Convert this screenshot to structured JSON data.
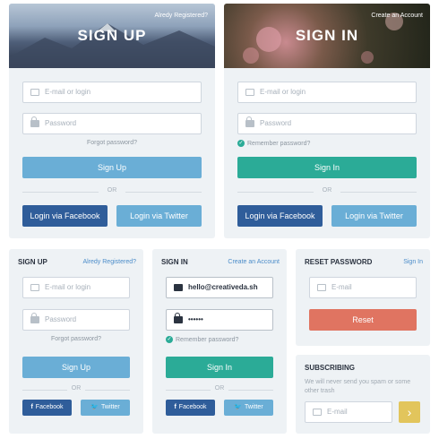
{
  "card1": {
    "title": "SIGN UP",
    "top_link": "Alredy Registered?",
    "email_placeholder": "E-mail or login",
    "password_placeholder": "Password",
    "forgot": "Forgot password?",
    "primary_button": "Sign Up",
    "or": "OR",
    "fb_button": "Login via Facebook",
    "tw_button": "Login via Twitter"
  },
  "card2": {
    "title": "SIGN IN",
    "top_link": "Create an Account",
    "email_placeholder": "E-mail or login",
    "password_placeholder": "Password",
    "remember": "Remember password?",
    "primary_button": "Sign In",
    "or": "OR",
    "fb_button": "Login via Facebook",
    "tw_button": "Login via Twitter"
  },
  "card3": {
    "title": "SIGN UP",
    "top_link": "Alredy Registered?",
    "email_placeholder": "E-mail or login",
    "password_placeholder": "Password",
    "forgot": "Forgot password?",
    "primary_button": "Sign Up",
    "or": "OR",
    "fb_button": "Facebook",
    "tw_button": "Twitter"
  },
  "card4": {
    "title": "SIGN IN",
    "top_link": "Create an Account",
    "email_value": "hello@creativeda.sh",
    "password_value": "••••••",
    "remember": "Remember password?",
    "primary_button": "Sign In",
    "or": "OR",
    "fb_button": "Facebook",
    "tw_button": "Twitter"
  },
  "card5": {
    "title": "RESET PASSWORD",
    "top_link": "Sign In",
    "email_placeholder": "E-mail",
    "primary_button": "Reset"
  },
  "card6": {
    "title": "SUBSCRIBING",
    "description": "We will never send you spam or some other trash",
    "email_placeholder": "E-mail",
    "submit_icon": "›"
  },
  "colors": {
    "primary_blue": "#6aaed6",
    "teal": "#2bab97",
    "facebook": "#2f5d9a",
    "reset_red": "#e07461",
    "subscribe_yellow": "#e2c55c",
    "card_bg": "#eef2f5"
  }
}
